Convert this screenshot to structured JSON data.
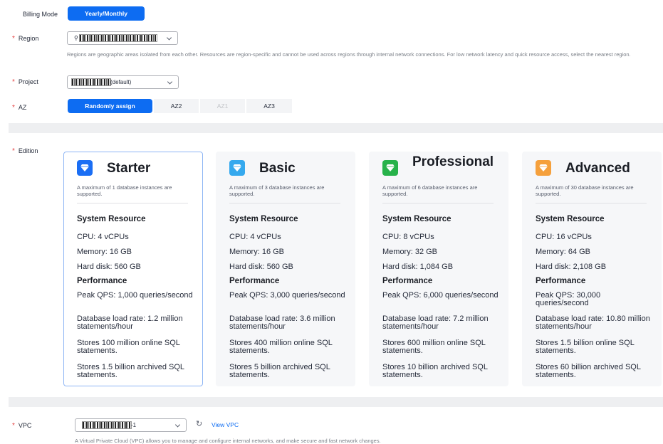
{
  "billing": {
    "label": "Billing Mode",
    "value": "Yearly/Monthly"
  },
  "region": {
    "label": "Region",
    "help": "Regions are geographic areas isolated from each other. Resources are region-specific and cannot be used across regions through internal network connections. For low network latency and quick resource access, select the nearest region."
  },
  "project": {
    "label": "Project",
    "suffix": "(default)"
  },
  "az": {
    "label": "AZ",
    "options": [
      {
        "label": "Randomly assign",
        "state": "selected"
      },
      {
        "label": "AZ2",
        "state": "normal"
      },
      {
        "label": "AZ1",
        "state": "disabled"
      },
      {
        "label": "AZ3",
        "state": "normal"
      }
    ]
  },
  "edition": {
    "label": "Edition",
    "cards": [
      {
        "title": "Starter",
        "icon": "diamond-icon",
        "icon_color": "#1a6ef4",
        "selected": true,
        "desc": "A maximum of 1 database instances are supported.",
        "sys_heading": "System Resource",
        "cpu": "CPU: 4 vCPUs",
        "memory": "Memory: 16 GB",
        "disk": "Hard disk: 560 GB",
        "perf_heading": "Performance",
        "qps": "Peak QPS: 1,000 queries/second",
        "load": "Database load rate: 1.2 million statements/hour",
        "online": "Stores 100 million online SQL statements.",
        "archived": "Stores 1.5 billion archived SQL statements."
      },
      {
        "title": "Basic",
        "icon": "diamond-icon",
        "icon_color": "#35a9ee",
        "selected": false,
        "desc": "A maximum of 3 database instances are supported.",
        "sys_heading": "System Resource",
        "cpu": "CPU: 4 vCPUs",
        "memory": "Memory: 16 GB",
        "disk": "Hard disk: 560 GB",
        "perf_heading": "Performance",
        "qps": "Peak QPS: 3,000 queries/second",
        "load": "Database load rate: 3.6 million statements/hour",
        "online": "Stores 400 million online SQL statements.",
        "archived": "Stores 5 billion archived SQL statements."
      },
      {
        "title": "Professional",
        "icon": "diamond-icon",
        "icon_color": "#27b24a",
        "selected": false,
        "desc": "A maximum of 6 database instances are supported.",
        "sys_heading": "System Resource",
        "cpu": "CPU: 8 vCPUs",
        "memory": "Memory: 32 GB",
        "disk": "Hard disk: 1,084 GB",
        "perf_heading": "Performance",
        "qps": "Peak QPS: 6,000 queries/second",
        "load": "Database load rate: 7.2 million statements/hour",
        "online": "Stores 600 million online SQL statements.",
        "archived": "Stores 10 billion archived SQL statements."
      },
      {
        "title": "Advanced",
        "icon": "diamond-icon",
        "icon_color": "#f5a03c",
        "selected": false,
        "desc": "A maximum of 30 database instances are supported.",
        "sys_heading": "System Resource",
        "cpu": "CPU: 16 vCPUs",
        "memory": "Memory: 64 GB",
        "disk": "Hard disk: 2,108 GB",
        "perf_heading": "Performance",
        "qps": "Peak QPS: 30,000 queries/second",
        "load": "Database load rate: 10.80 million statements/hour",
        "online": "Stores 1.5 billion online SQL statements.",
        "archived": "Stores 60 billion archived SQL statements."
      }
    ]
  },
  "vpc": {
    "label": "VPC",
    "suffix": "-1",
    "link": "View VPC",
    "help": "A Virtual Private Cloud (VPC) allows you to manage and configure internal networks, and make secure and fast network changes."
  },
  "colors": {
    "primary": "#0d6cf2",
    "required": "#e54545"
  }
}
